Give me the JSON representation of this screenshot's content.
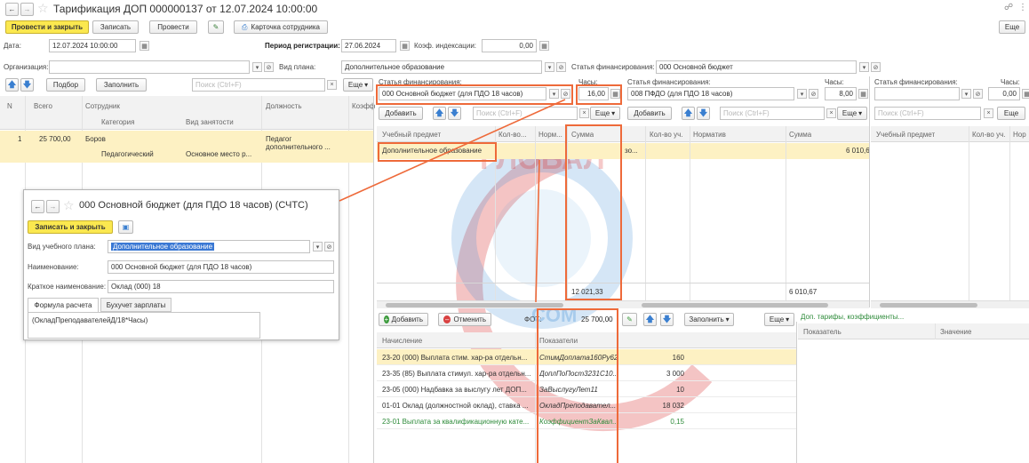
{
  "window": {
    "title": "Тарификация ДОП 000000137 от 12.07.2024 10:00:00",
    "link_icon": "link-icon",
    "more_icon": "kebab-icon"
  },
  "toolbar": {
    "post_close": "Провести и закрыть",
    "save": "Записать",
    "post": "Провести",
    "employee_card": "Карточка сотрудника",
    "more": "Еще"
  },
  "header": {
    "date_label": "Дата:",
    "date_value": "12.07.2024 10:00:00",
    "period_label": "Период регистрации:",
    "period_value": "27.06.2024",
    "index_label": "Коэф. индексации:",
    "index_value": "0,00",
    "org_label": "Организация:",
    "plan_label": "Вид плана:",
    "plan_value": "Дополнительное образование",
    "fin_label": "Статья финансирования:",
    "fin_value": "000 Основной бюджет"
  },
  "left_panel": {
    "pick": "Подбор",
    "fill": "Заполнить",
    "search_placeholder": "Поиск (Ctrl+F)",
    "more": "Еще",
    "columns": {
      "n": "N",
      "total": "Всего",
      "employee": "Сотрудник",
      "category": "Категория",
      "employment": "Вид занятости",
      "position": "Должность",
      "coef": "Коэфф"
    },
    "rows": [
      {
        "n": "1",
        "total": "25 700,00",
        "employee": "Боров",
        "category": "Педагогический",
        "employment": "Основное место р...",
        "position_1": "Педагог",
        "position_2": "дополнительного ..."
      }
    ]
  },
  "middle_panel": {
    "fin_label": "Статья финансирования:",
    "fin_value": "000 Основной бюджет (для ПДО 18 часов)",
    "hours_label": "Часы:",
    "hours_value": "16,00",
    "add": "Добавить",
    "search_placeholder": "Поиск (Ctrl+F)",
    "more": "Еще",
    "columns": {
      "subject": "Учебный предмет",
      "qty": "Кол-во...",
      "norm": "Норм...",
      "sum": "Сумма"
    },
    "row_subject": "Дополнительное образование",
    "total_sum": "12 021,33"
  },
  "middle2_panel": {
    "fin_label": "Статья финансирования:",
    "fin_value": "008 ПФДО (для ПДО 18 часов)",
    "hours_label": "Часы:",
    "hours_value": "8,00",
    "add": "Добавить",
    "search_placeholder": "Поиск (Ctrl+F)",
    "more": "Еще",
    "columns": {
      "qty": "Кол-во уч.",
      "norm": "Норматив",
      "sum": "Сумма"
    },
    "row_cut": "зо...",
    "row_sum": "6 010,6",
    "total_sum": "6 010,67"
  },
  "right_panel": {
    "fin_label": "Статья финансирования:",
    "hours_label": "Часы:",
    "hours_value": "0,00",
    "search_placeholder": "Поиск (Ctrl+F)",
    "more": "Еще",
    "columns": {
      "subject": "Учебный предмет",
      "qty": "Кол-во уч.",
      "norm": "Нор"
    }
  },
  "bottom_bar": {
    "add": "Добавить",
    "cancel": "Отменить",
    "fot_label": "ФОТ:",
    "fot_value": "25 700,00",
    "fill": "Заполнить",
    "more": "Еще",
    "extra_link": "Доп. тарифы, коэффициенты..."
  },
  "accruals": {
    "columns": {
      "accrual": "Начисление",
      "indicators": "Показатели"
    },
    "rows": [
      {
        "accrual": "23-20 (000) Выплата стим. хар-ра отдельн...",
        "indicator": "СтимДоплата160Ру62",
        "value": "160",
        "green": false
      },
      {
        "accrual": "23-35 (85) Выплата стимул. хар-ра отдельн...",
        "indicator": "ДоплПоПост3231С10...",
        "value": "3 000",
        "green": false
      },
      {
        "accrual": "23-05 (000) Надбавка за выслугу лет ДОП...",
        "indicator": "ЗаВыслугуЛет11",
        "value": "10",
        "green": false
      },
      {
        "accrual": "01-01 Оклад (должностной оклад), ставка ...",
        "indicator": "ОкладПреподавател...",
        "value": "18 032",
        "green": false
      },
      {
        "accrual": "23-01 Выплата за квалификационную кате...",
        "indicator": "КоэффициентЗаКвал...",
        "value": "0,15",
        "green": true
      }
    ]
  },
  "indicator_panel": {
    "columns": {
      "indicator": "Показатель",
      "value": "Значение"
    }
  },
  "popup": {
    "title": "000 Основной бюджет (для ПДО 18 часов) (СЧТС)",
    "save_close": "Записать и закрыть",
    "plan_label": "Вид учебного плана:",
    "plan_value": "Дополнительное образование",
    "name_label": "Наименование:",
    "name_value": "000 Основной бюджет (для ПДО 18 часов)",
    "short_label": "Краткое наименование:",
    "short_value": "Оклад (000) 18",
    "tab_formula": "Формула расчета",
    "tab_accounting": "Бухучет зарплаты",
    "formula": "(ОкладПреподавателейД/18*Часы)"
  },
  "watermark": {
    "text": "ГЛОБАЛ",
    "sub": "COM"
  },
  "colors": {
    "accent_yellow": "#fbe84f",
    "highlight_orange": "#ee6a3a",
    "row_selected": "#fdf1c3",
    "green_text": "#2e8b3a",
    "watermark_red": "#d92c2c",
    "watermark_blue": "#3f8fd6"
  }
}
